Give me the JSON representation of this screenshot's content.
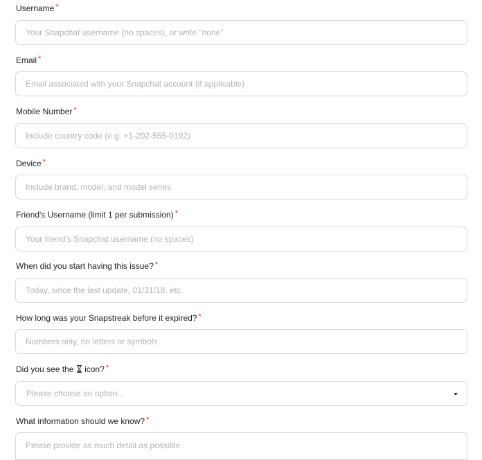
{
  "required_marker": "*",
  "fields": [
    {
      "label": "Username",
      "placeholder": "Your Snapchat username (no spaces), or write \"none\""
    },
    {
      "label": "Email",
      "placeholder": "Email associated with your Snapchat account (if applicable)"
    },
    {
      "label": "Mobile Number",
      "placeholder": "Include country code (e.g. +1-202-555-0192)"
    },
    {
      "label": "Device",
      "placeholder": "Include brand, model, and model series"
    },
    {
      "label": "Friend's Username (limit 1 per submission)",
      "placeholder": "Your friend's Snapchat username (no spaces)"
    },
    {
      "label": "When did you start having this issue?",
      "placeholder": "Today, since the last update, 01/31/18, etc."
    },
    {
      "label": "How long was your Snapstreak before it expired?",
      "placeholder": "Numbers only, no letters or symbols"
    }
  ],
  "icon_question": {
    "label_before": "Did you see the",
    "icon": "hourglass-icon",
    "label_after": "icon?",
    "selected_value": "Please choose an option..."
  },
  "info_field": {
    "label": "What information should we know?",
    "placeholder": "Please provide as much detail as possible"
  },
  "colors": {
    "required": "#e02a2a",
    "border": "#d9d9d9",
    "placeholder": "#b3b3b3"
  }
}
